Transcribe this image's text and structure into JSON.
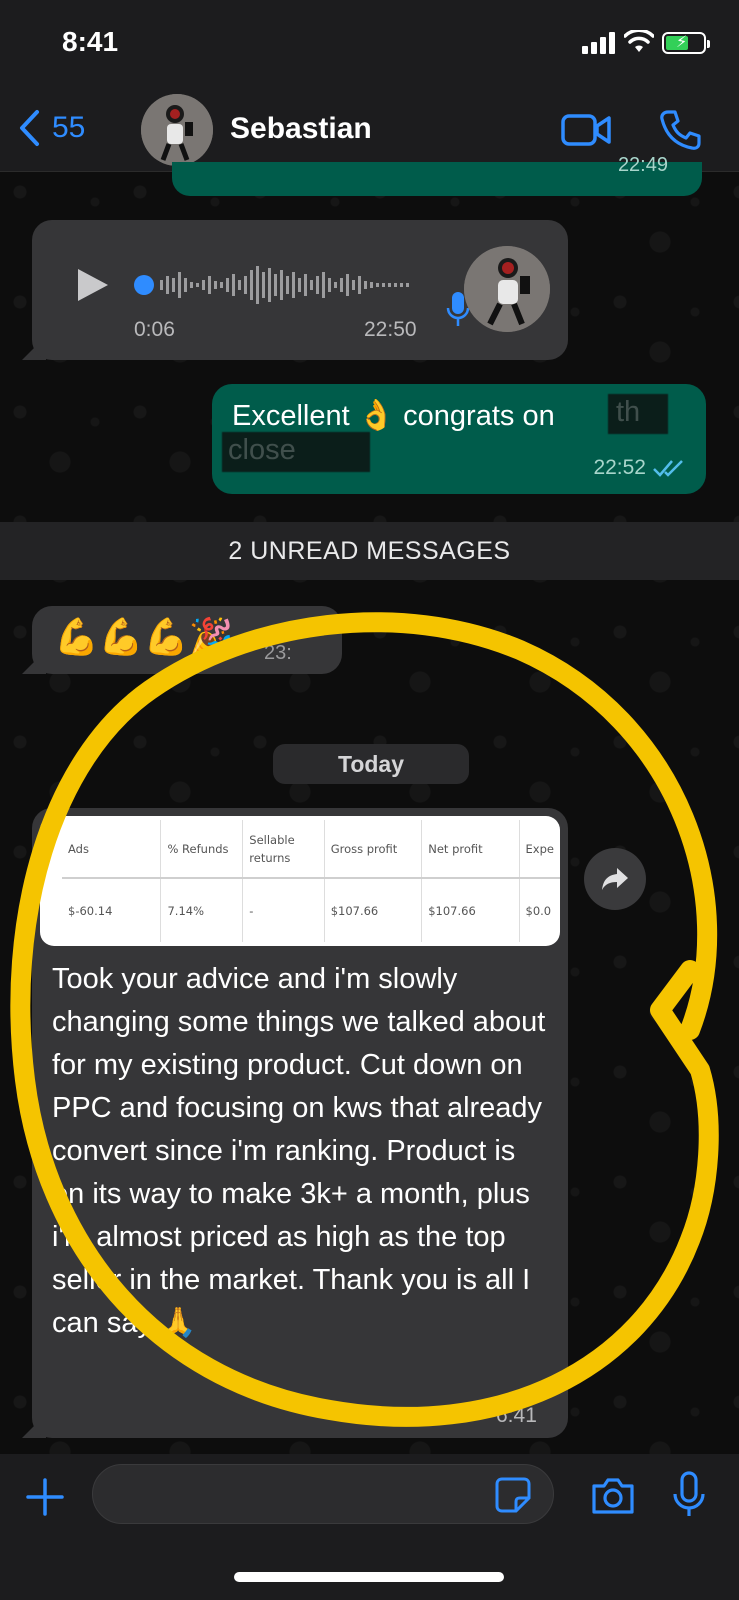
{
  "status_bar": {
    "time": "8:41"
  },
  "header": {
    "back_count": "55",
    "contact_name": "Sebastian"
  },
  "messages": {
    "previous_time": "22:49",
    "voice": {
      "duration": "0:06",
      "time": "22:50"
    },
    "excellent": {
      "text_before": "Excellent",
      "text_after": "congrats on",
      "redacted_ghost_1": "th",
      "redacted_ghost_2": "close",
      "time": "22:52"
    },
    "unread_label": "2 UNREAD MESSAGES",
    "emoji_message": {
      "text": "💪💪💪🎉",
      "time": "23:"
    },
    "date_label": "Today",
    "main": {
      "table": {
        "headers": [
          "Ads",
          "% Refunds",
          "Sellable returns",
          "Gross profit",
          "Net profit",
          "Expe"
        ],
        "values": [
          "$-60.14",
          "7.14%",
          "-",
          "$107.66",
          "$107.66",
          "$0.0"
        ]
      },
      "text": "Took your advice and i'm slowly changing some things we talked about for my existing product. Cut down on PPC and focusing on kws that already convert since i'm ranking. Product is on its way to make 3k+ a month, plus i'm almost priced as high as the top seller in the market. Thank you is all I can say 🙏",
      "time": "6:41"
    }
  },
  "colors": {
    "accent": "#2f8cff",
    "outgoing_bubble": "#005c4b",
    "incoming_bubble": "#363638",
    "highlight_circle": "#f5c400"
  },
  "icons": [
    "back-chevron-icon",
    "video-call-icon",
    "phone-icon",
    "play-icon",
    "mic-icon",
    "double-check-icon",
    "forward-icon",
    "plus-icon",
    "sticker-icon",
    "camera-icon"
  ]
}
